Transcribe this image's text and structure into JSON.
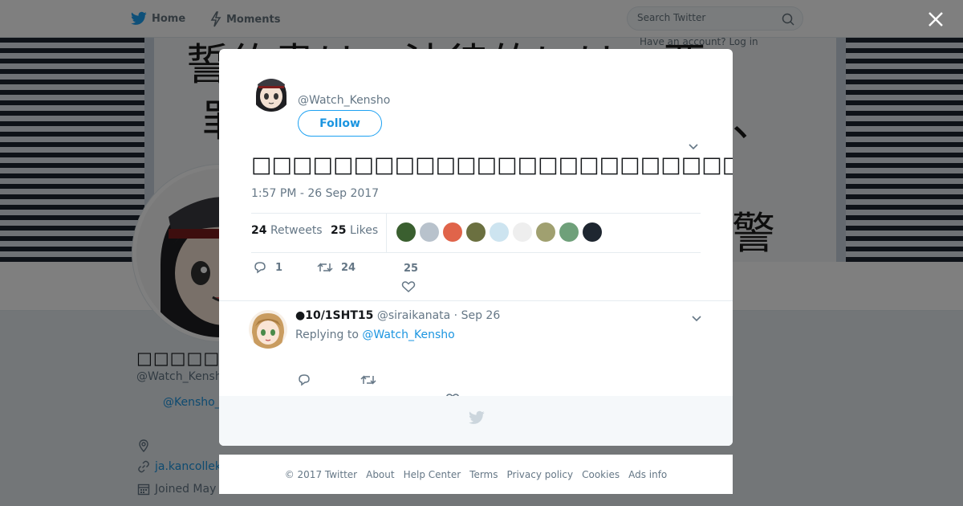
{
  "nav": {
    "home_label": "Home",
    "moments_label": "Moments",
    "search_placeholder": "Search Twitter",
    "have_account_text": "Have an account? Log in"
  },
  "background_profile": {
    "name": "□□□□□□□□□□□",
    "handle": "@Watch_Kensho",
    "mention": "@Kensho_",
    "link": "ja.kancollek",
    "joined": "Joined May"
  },
  "tweet": {
    "handle": "@Watch_Kensho",
    "follow_label": "Follow",
    "text": "□□□□□□□□□□□□□□□□□□□□□□□□□□□□□□□□□□□□□□□□□□□□□□……",
    "timestamp": "1:57 PM - 26 Sep 2017",
    "retweets_count": "24",
    "retweets_label": "Retweets",
    "likes_count": "25",
    "likes_label": "Likes",
    "reply_count": "1",
    "retweet_count": "24",
    "like_count": "25",
    "liker_avatars": [
      {
        "color": "#3a5f2f"
      },
      {
        "color": "#b8c2cc"
      },
      {
        "color": "#e0644a"
      },
      {
        "color": "#6b7040"
      },
      {
        "color": "#cde4f0"
      },
      {
        "color": "#eeeeee"
      },
      {
        "color": "#a0a070"
      },
      {
        "color": "#6fa07a"
      },
      {
        "color": "#1e2630"
      }
    ]
  },
  "reply": {
    "name": "●10/1SHT15",
    "handle": "@siraikanata",
    "date": "· Sep 26",
    "replying_prefix": "Replying to",
    "replying_to": "@Watch_Kensho"
  },
  "footer": {
    "links": [
      "© 2017 Twitter",
      "About",
      "Help Center",
      "Terms",
      "Privacy policy",
      "Cookies",
      "Ads info"
    ]
  },
  "colors": {
    "twitter_blue": "#1da1f2",
    "link_blue": "#1b95e0",
    "muted_text": "#657786"
  }
}
